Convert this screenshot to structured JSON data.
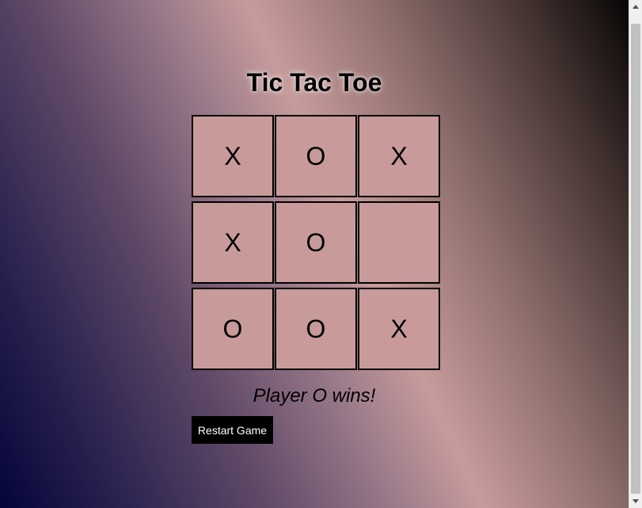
{
  "game": {
    "title": "Tic Tac Toe",
    "board": [
      "X",
      "O",
      "X",
      "X",
      "O",
      "",
      "O",
      "O",
      "X"
    ],
    "status": "Player O wins!",
    "restart_label": "Restart Game"
  },
  "scrollbar": {
    "up_icon": "triangle-up",
    "down_icon": "triangle-down"
  }
}
